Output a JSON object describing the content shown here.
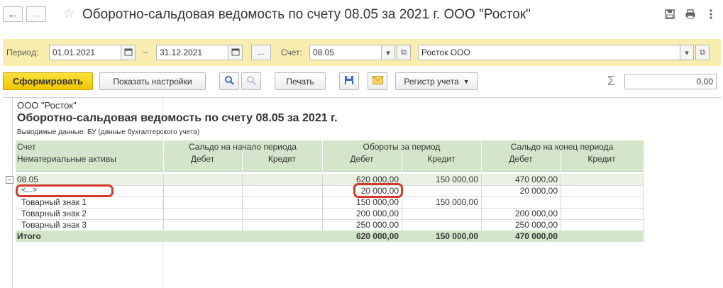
{
  "window": {
    "title": "Оборотно-сальдовая ведомость по счету 08.05 за 2021 г. ООО \"Росток\""
  },
  "filters": {
    "period_label": "Период:",
    "date_from": "01.01.2021",
    "dash": "–",
    "date_to": "31.12.2021",
    "dots": "...",
    "account_label": "Счет:",
    "account": "08.05",
    "organization": "Росток ООО"
  },
  "toolbar": {
    "generate": "Сформировать",
    "show_settings": "Показать настройки",
    "print": "Печать",
    "registry": "Регистр учета",
    "sum_value": "0,00"
  },
  "report": {
    "org": "ООО \"Росток\"",
    "title": "Оборотно-сальдовая ведомость по счету 08.05 за 2021 г.",
    "output_data": "Выводимые данные:  БУ (данные бухгалтерского учета)",
    "header": {
      "account": "Счет",
      "subaccount": "Нематериальные активы",
      "opening": "Сальдо на начало периода",
      "turnover": "Обороты за период",
      "closing": "Сальдо на конец периода",
      "debit": "Дебет",
      "credit": "Кредит"
    },
    "rows": [
      {
        "name": "08.05",
        "open_d": "",
        "open_c": "",
        "turn_d": "620 000,00",
        "turn_c": "150 000,00",
        "close_d": "470 000,00",
        "close_c": ""
      },
      {
        "name": "<...>",
        "open_d": "",
        "open_c": "",
        "turn_d": "20 000,00",
        "turn_c": "",
        "close_d": "20 000,00",
        "close_c": ""
      },
      {
        "name": "Товарный знак 1",
        "open_d": "",
        "open_c": "",
        "turn_d": "150 000,00",
        "turn_c": "150 000,00",
        "close_d": "",
        "close_c": ""
      },
      {
        "name": "Товарный знак 2",
        "open_d": "",
        "open_c": "",
        "turn_d": "200 000,00",
        "turn_c": "",
        "close_d": "200 000,00",
        "close_c": ""
      },
      {
        "name": "Товарный знак 3",
        "open_d": "",
        "open_c": "",
        "turn_d": "250 000,00",
        "turn_c": "",
        "close_d": "250 000,00",
        "close_c": ""
      }
    ],
    "total": {
      "name": "Итого",
      "open_d": "",
      "open_c": "",
      "turn_d": "620 000,00",
      "turn_c": "150 000,00",
      "close_d": "470 000,00",
      "close_c": ""
    }
  },
  "colors": {
    "panel": "#f9eeb0",
    "header_green": "#d4e6c9",
    "primary_button": "#f2c500",
    "highlight": "#d33a2c"
  }
}
